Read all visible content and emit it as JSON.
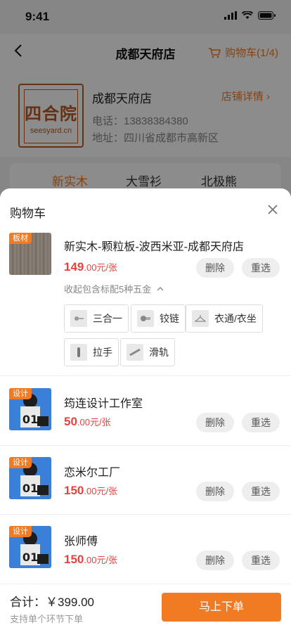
{
  "status_bar": {
    "time": "9:41"
  },
  "nav": {
    "title": "成都天府店",
    "cart_label": "购物车(1/4)"
  },
  "store": {
    "logo_text": "四合院",
    "logo_sub": "seesyard.cn",
    "name": "成都天府店",
    "detail_link": "店铺详情",
    "phone": "电话：13838384380",
    "address": "地址：四川省成都市高新区"
  },
  "brand_tabs": [
    "新实木",
    "大雪衫",
    "北极熊"
  ],
  "cart": {
    "title": "购物车",
    "items": [
      {
        "badge": "板材",
        "name": "新实木-颗粒板-波西米亚-成都天府店",
        "price": "149",
        "price_unit": ".00元/张",
        "delete": "删除",
        "reselect": "重选",
        "toggle": "收起包含标配5种五金",
        "hardware": [
          "三合一",
          "铰链",
          "衣通/衣坐",
          "拉手",
          "滑轨"
        ]
      },
      {
        "badge": "设计",
        "name": "筠连设计工作室",
        "price": "50",
        "price_unit": ".00元/张",
        "delete": "删除",
        "reselect": "重选"
      },
      {
        "badge": "设计",
        "name": "恋米尔工厂",
        "price": "150",
        "price_unit": ".00元/张",
        "delete": "删除",
        "reselect": "重选"
      },
      {
        "badge": "设计",
        "name": "张师傅",
        "price": "150",
        "price_unit": ".00元/张",
        "delete": "删除",
        "reselect": "重选"
      }
    ]
  },
  "footer": {
    "total": "合计：￥399.00",
    "subtitle": "支持单个环节下单",
    "order_button": "马上下单"
  },
  "colors": {
    "accent": "#f07b23",
    "price": "#e64340",
    "logo": "#b65a25"
  }
}
